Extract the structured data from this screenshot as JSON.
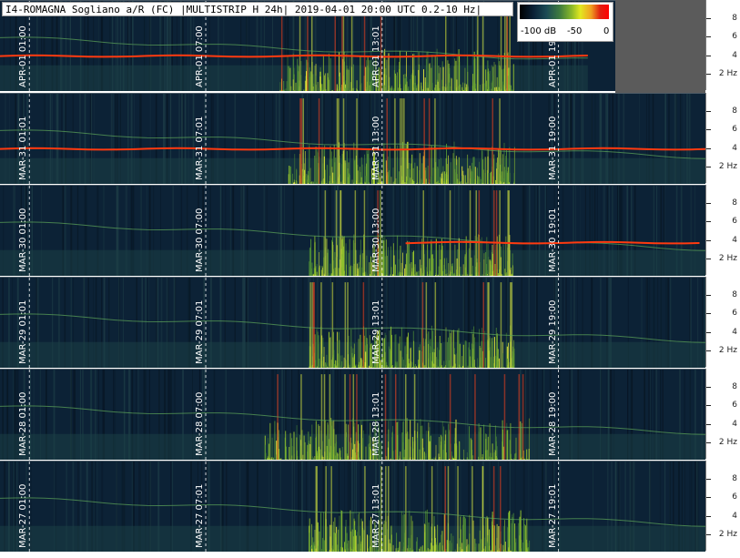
{
  "header": {
    "title": "I4-ROMAGNA Sogliano a/R (FC) |MULTISTRIP H 24h| 2019-04-01 20:00 UTC 0.2-10 Hz|"
  },
  "colorbar": {
    "labels": [
      "-100 dB",
      "-50",
      "0"
    ]
  },
  "axis": {
    "ticks": [
      "8",
      "6",
      "4",
      "2 Hz"
    ]
  },
  "chart_data": {
    "type": "heatmap",
    "title": "I4-ROMAGNA Sogliano a/R (FC) |MULTISTRIP H 24h| 2019-04-01 20:00 UTC 0.2-10 Hz|",
    "xlabel": "",
    "ylabel": "",
    "ylim": [
      0.2,
      10
    ],
    "color_scale_db": [
      -100,
      0
    ],
    "strips": [
      {
        "day": "APR-01",
        "time_labels": [
          "APR-01 01:00",
          "APR-01 07:00",
          "APR-01 13:01",
          "APR-01 19:"
        ],
        "tone_hz": 4.0,
        "activity_start_h": 9.5,
        "activity_end_h": 17.5,
        "partial_end_h": 20.0
      },
      {
        "day": "MAR-31",
        "time_labels": [
          "MAR-31 01:01",
          "MAR-31 07:01",
          "MAR-31 13:00",
          "MAR-31 19:00"
        ],
        "tone_hz": 4.0,
        "activity_start_h": 9.8,
        "activity_end_h": 17.5,
        "partial_end_h": 24.0
      },
      {
        "day": "MAR-30",
        "time_labels": [
          "MAR-30 01:00",
          "MAR-30 07:00",
          "MAR-30 13:00",
          "MAR-30 19:01"
        ],
        "tone_hz": 3.8,
        "activity_start_h": 10.5,
        "activity_end_h": 17.5,
        "partial_end_h": 24.0
      },
      {
        "day": "MAR-29",
        "time_labels": [
          "MAR-29 01:01",
          "MAR-29 07:01",
          "MAR-29 13:01",
          "MAR-29 19:00"
        ],
        "tone_hz": null,
        "activity_start_h": 10.5,
        "activity_end_h": 17.5,
        "partial_end_h": 24.0
      },
      {
        "day": "MAR-28",
        "time_labels": [
          "MAR-28 01:00",
          "MAR-28 07:00",
          "MAR-28 13:01",
          "MAR-28 19:00"
        ],
        "tone_hz": null,
        "activity_start_h": 9.0,
        "activity_end_h": 18.0,
        "partial_end_h": 24.0
      },
      {
        "day": "MAR-27",
        "time_labels": [
          "MAR-27 01:00",
          "MAR-27 07:01",
          "MAR-27 13:01",
          "MAR-27 19:01"
        ],
        "tone_hz": null,
        "activity_start_h": 10.5,
        "activity_end_h": 18.0,
        "partial_end_h": 24.0
      }
    ]
  }
}
